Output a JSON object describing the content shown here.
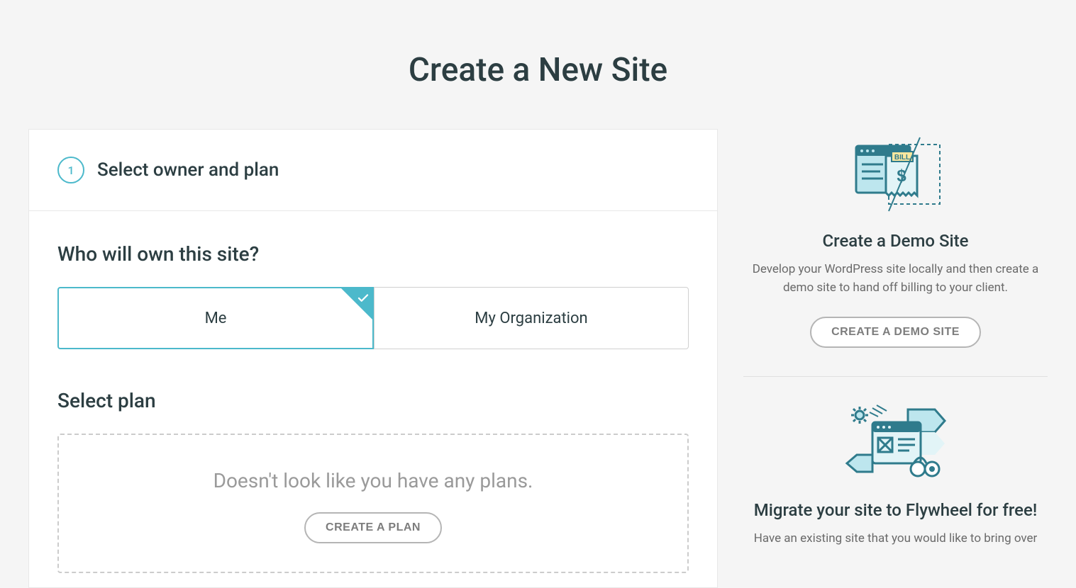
{
  "page_title": "Create a New Site",
  "step": {
    "number": "1",
    "title": "Select owner and plan"
  },
  "owner_section": {
    "heading": "Who will own this site?",
    "options": {
      "me": "Me",
      "org": "My Organization"
    }
  },
  "plan_section": {
    "heading": "Select plan",
    "empty_text": "Doesn't look like you have any plans.",
    "button": "CREATE A PLAN"
  },
  "sidebar": {
    "demo": {
      "title": "Create a Demo Site",
      "description": "Develop your WordPress site locally and then create a demo site to hand off billing to your client.",
      "button": "CREATE A DEMO SITE"
    },
    "migrate": {
      "title": "Migrate your site to Flywheel for free!",
      "description": "Have an existing site that you would like to bring over"
    }
  }
}
